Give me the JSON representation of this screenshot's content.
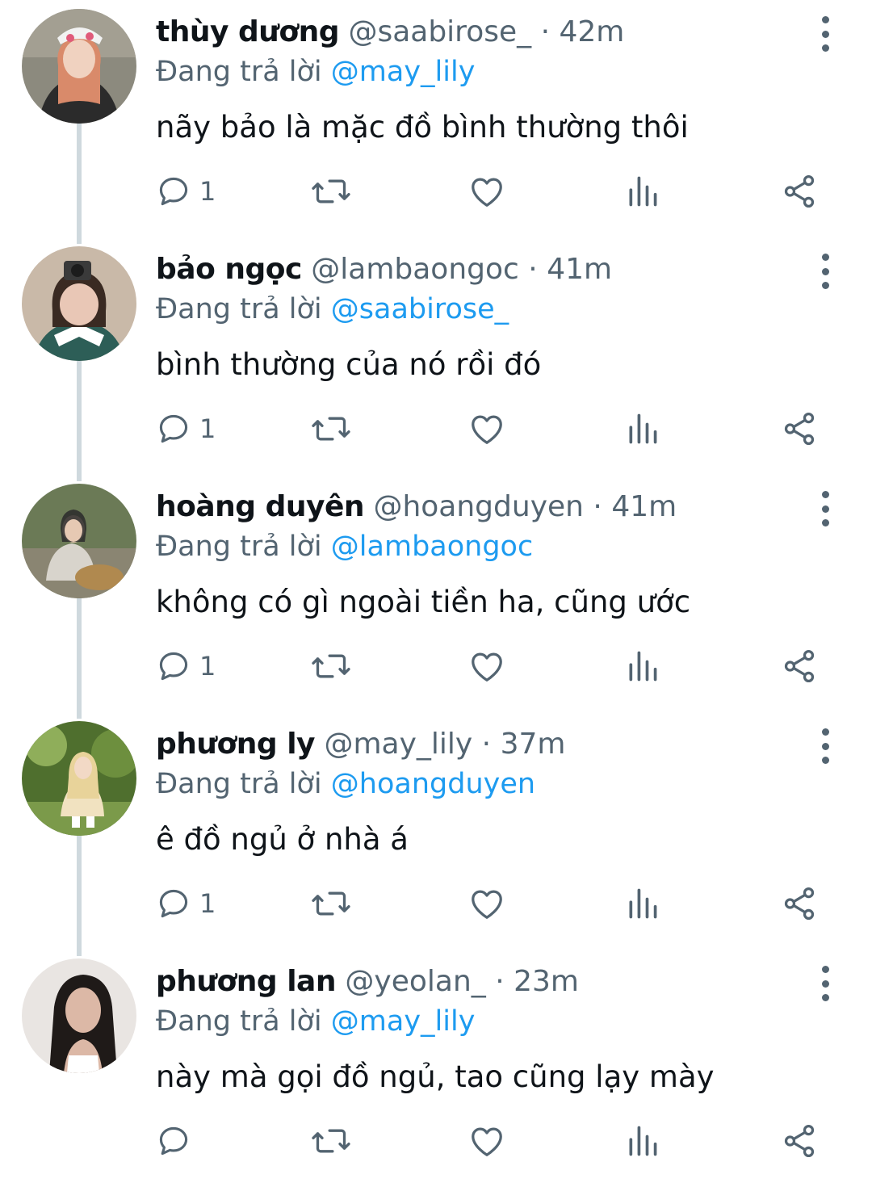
{
  "reply_prefix": "Đang trả lời",
  "tweets": [
    {
      "name": "thùy dương",
      "handle": "@saabirose_",
      "dot": "·",
      "time": "42m",
      "reply_to": "@may_lily",
      "text": "nãy bảo là mặc đồ bình thường thôi",
      "reply_count": "1",
      "avatar_palette": [
        "#8c8a7e",
        "#2b2b2b",
        "#d98a6a",
        "#f2f2f2"
      ]
    },
    {
      "name": "bảo ngọc",
      "handle": "@lambaongoc",
      "dot": "·",
      "time": "41m",
      "reply_to": "@saabirose_",
      "text": "bình thường của nó rồi đó",
      "reply_count": "1",
      "avatar_palette": [
        "#c9b9a8",
        "#2d5e57",
        "#e9c7b6",
        "#3a3a3a"
      ]
    },
    {
      "name": "hoàng duyên",
      "handle": "@hoangduyen",
      "dot": "·",
      "time": "41m",
      "reply_to": "@lambaongoc",
      "text": "không có gì ngoài tiền ha, cũng ước",
      "reply_count": "1",
      "avatar_palette": [
        "#6b7a56",
        "#d8d4cc",
        "#b0894f",
        "#2a2a2a"
      ]
    },
    {
      "name": "phương ly",
      "handle": "@may_lily",
      "dot": "·",
      "time": "37m",
      "reply_to": "@hoangduyen",
      "text": "ê đồ ngủ ở nhà á",
      "reply_count": "1",
      "avatar_palette": [
        "#4f6f2e",
        "#f1e2c0",
        "#8fae5a",
        "#e8d39a"
      ]
    },
    {
      "name": "phương lan",
      "handle": "@yeolan_",
      "dot": "·",
      "time": "23m",
      "reply_to": "@may_lily",
      "text": "này mà gọi đồ ngủ, tao cũng lạy mày",
      "reply_count": "",
      "avatar_palette": [
        "#e9e5e2",
        "#1f1a18",
        "#dcb8a6",
        "#ffffff"
      ]
    }
  ],
  "colors": {
    "text": "#0f1419",
    "secondary": "#536471",
    "accent": "#1d9bf0",
    "thread_line": "#cfd9de"
  },
  "icons": {
    "reply": "reply-icon",
    "retweet": "retweet-icon",
    "like": "like-icon",
    "views": "views-icon",
    "share": "share-icon",
    "more": "more-icon"
  }
}
